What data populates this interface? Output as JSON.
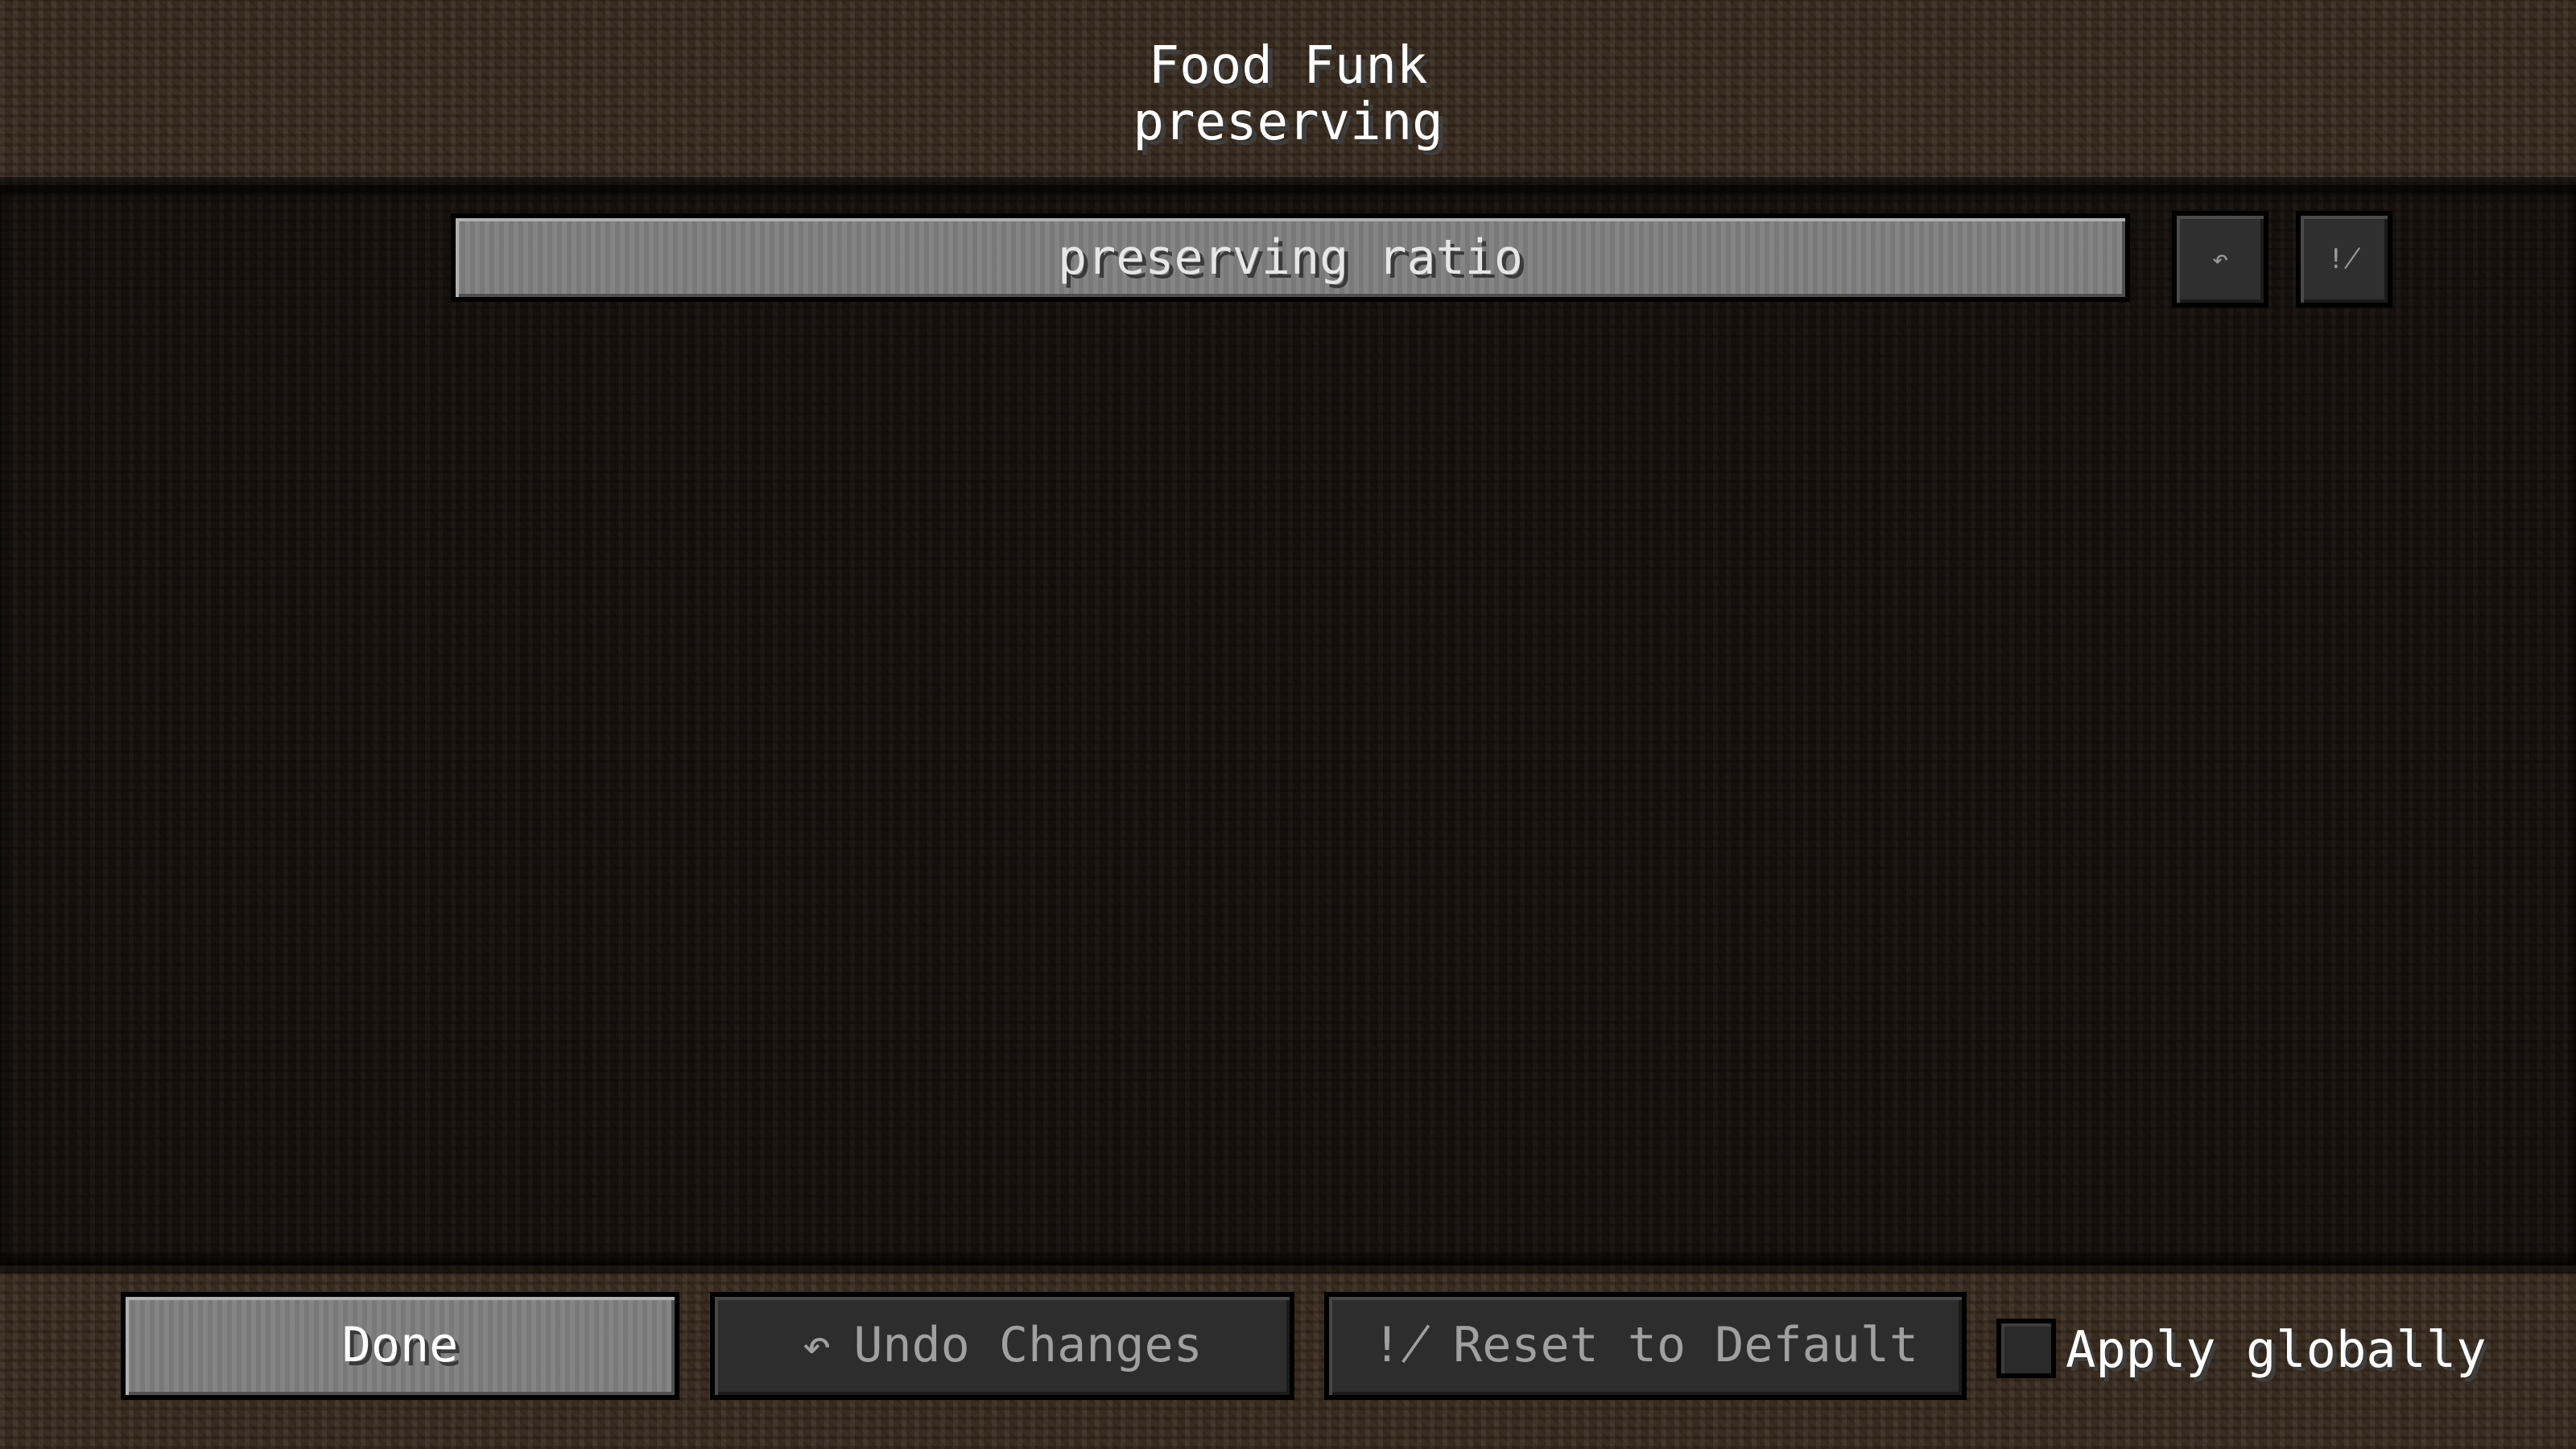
{
  "header": {
    "title": "Food Funk",
    "subtitle": "preserving"
  },
  "list": {
    "entries": [
      {
        "label": "preserving ratio",
        "undo_icon": "undo-arrow-icon",
        "reset_icon": "reset-icon"
      }
    ]
  },
  "footer": {
    "done_label": "Done",
    "undo_label": "Undo Changes",
    "reset_label": "Reset to Default",
    "apply_globally_label": "Apply globally",
    "apply_globally_checked": false
  },
  "icons": {
    "undo": "↶",
    "reset": "!̸"
  },
  "colors": {
    "button_active": "#7d7d7d",
    "button_disabled": "#2d2d2d",
    "text": "#ffffff",
    "text_disabled": "#a0a0a0"
  }
}
